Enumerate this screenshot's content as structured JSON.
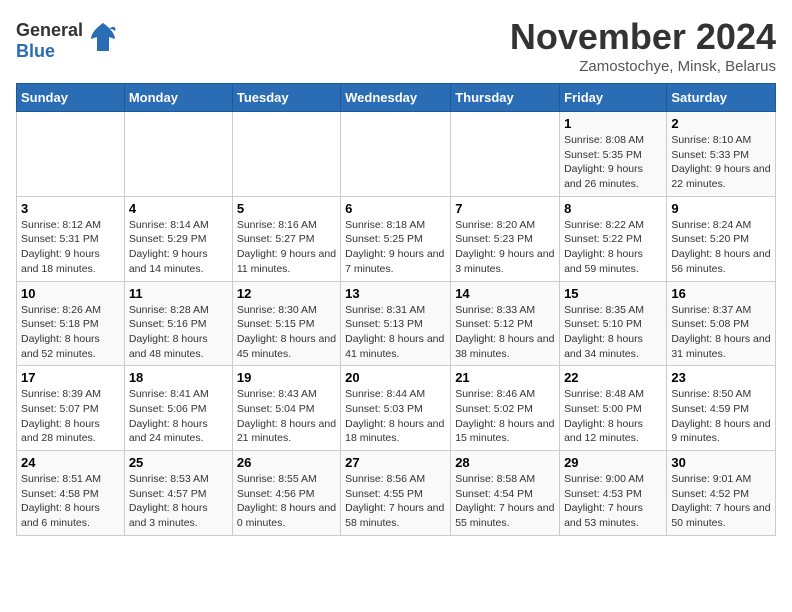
{
  "logo": {
    "line1": "General",
    "line2": "Blue"
  },
  "title": "November 2024",
  "subtitle": "Zamostochye, Minsk, Belarus",
  "days_of_week": [
    "Sunday",
    "Monday",
    "Tuesday",
    "Wednesday",
    "Thursday",
    "Friday",
    "Saturday"
  ],
  "weeks": [
    [
      {
        "day": "",
        "info": ""
      },
      {
        "day": "",
        "info": ""
      },
      {
        "day": "",
        "info": ""
      },
      {
        "day": "",
        "info": ""
      },
      {
        "day": "",
        "info": ""
      },
      {
        "day": "1",
        "info": "Sunrise: 8:08 AM\nSunset: 5:35 PM\nDaylight: 9 hours and 26 minutes."
      },
      {
        "day": "2",
        "info": "Sunrise: 8:10 AM\nSunset: 5:33 PM\nDaylight: 9 hours and 22 minutes."
      }
    ],
    [
      {
        "day": "3",
        "info": "Sunrise: 8:12 AM\nSunset: 5:31 PM\nDaylight: 9 hours and 18 minutes."
      },
      {
        "day": "4",
        "info": "Sunrise: 8:14 AM\nSunset: 5:29 PM\nDaylight: 9 hours and 14 minutes."
      },
      {
        "day": "5",
        "info": "Sunrise: 8:16 AM\nSunset: 5:27 PM\nDaylight: 9 hours and 11 minutes."
      },
      {
        "day": "6",
        "info": "Sunrise: 8:18 AM\nSunset: 5:25 PM\nDaylight: 9 hours and 7 minutes."
      },
      {
        "day": "7",
        "info": "Sunrise: 8:20 AM\nSunset: 5:23 PM\nDaylight: 9 hours and 3 minutes."
      },
      {
        "day": "8",
        "info": "Sunrise: 8:22 AM\nSunset: 5:22 PM\nDaylight: 8 hours and 59 minutes."
      },
      {
        "day": "9",
        "info": "Sunrise: 8:24 AM\nSunset: 5:20 PM\nDaylight: 8 hours and 56 minutes."
      }
    ],
    [
      {
        "day": "10",
        "info": "Sunrise: 8:26 AM\nSunset: 5:18 PM\nDaylight: 8 hours and 52 minutes."
      },
      {
        "day": "11",
        "info": "Sunrise: 8:28 AM\nSunset: 5:16 PM\nDaylight: 8 hours and 48 minutes."
      },
      {
        "day": "12",
        "info": "Sunrise: 8:30 AM\nSunset: 5:15 PM\nDaylight: 8 hours and 45 minutes."
      },
      {
        "day": "13",
        "info": "Sunrise: 8:31 AM\nSunset: 5:13 PM\nDaylight: 8 hours and 41 minutes."
      },
      {
        "day": "14",
        "info": "Sunrise: 8:33 AM\nSunset: 5:12 PM\nDaylight: 8 hours and 38 minutes."
      },
      {
        "day": "15",
        "info": "Sunrise: 8:35 AM\nSunset: 5:10 PM\nDaylight: 8 hours and 34 minutes."
      },
      {
        "day": "16",
        "info": "Sunrise: 8:37 AM\nSunset: 5:08 PM\nDaylight: 8 hours and 31 minutes."
      }
    ],
    [
      {
        "day": "17",
        "info": "Sunrise: 8:39 AM\nSunset: 5:07 PM\nDaylight: 8 hours and 28 minutes."
      },
      {
        "day": "18",
        "info": "Sunrise: 8:41 AM\nSunset: 5:06 PM\nDaylight: 8 hours and 24 minutes."
      },
      {
        "day": "19",
        "info": "Sunrise: 8:43 AM\nSunset: 5:04 PM\nDaylight: 8 hours and 21 minutes."
      },
      {
        "day": "20",
        "info": "Sunrise: 8:44 AM\nSunset: 5:03 PM\nDaylight: 8 hours and 18 minutes."
      },
      {
        "day": "21",
        "info": "Sunrise: 8:46 AM\nSunset: 5:02 PM\nDaylight: 8 hours and 15 minutes."
      },
      {
        "day": "22",
        "info": "Sunrise: 8:48 AM\nSunset: 5:00 PM\nDaylight: 8 hours and 12 minutes."
      },
      {
        "day": "23",
        "info": "Sunrise: 8:50 AM\nSunset: 4:59 PM\nDaylight: 8 hours and 9 minutes."
      }
    ],
    [
      {
        "day": "24",
        "info": "Sunrise: 8:51 AM\nSunset: 4:58 PM\nDaylight: 8 hours and 6 minutes."
      },
      {
        "day": "25",
        "info": "Sunrise: 8:53 AM\nSunset: 4:57 PM\nDaylight: 8 hours and 3 minutes."
      },
      {
        "day": "26",
        "info": "Sunrise: 8:55 AM\nSunset: 4:56 PM\nDaylight: 8 hours and 0 minutes."
      },
      {
        "day": "27",
        "info": "Sunrise: 8:56 AM\nSunset: 4:55 PM\nDaylight: 7 hours and 58 minutes."
      },
      {
        "day": "28",
        "info": "Sunrise: 8:58 AM\nSunset: 4:54 PM\nDaylight: 7 hours and 55 minutes."
      },
      {
        "day": "29",
        "info": "Sunrise: 9:00 AM\nSunset: 4:53 PM\nDaylight: 7 hours and 53 minutes."
      },
      {
        "day": "30",
        "info": "Sunrise: 9:01 AM\nSunset: 4:52 PM\nDaylight: 7 hours and 50 minutes."
      }
    ]
  ]
}
